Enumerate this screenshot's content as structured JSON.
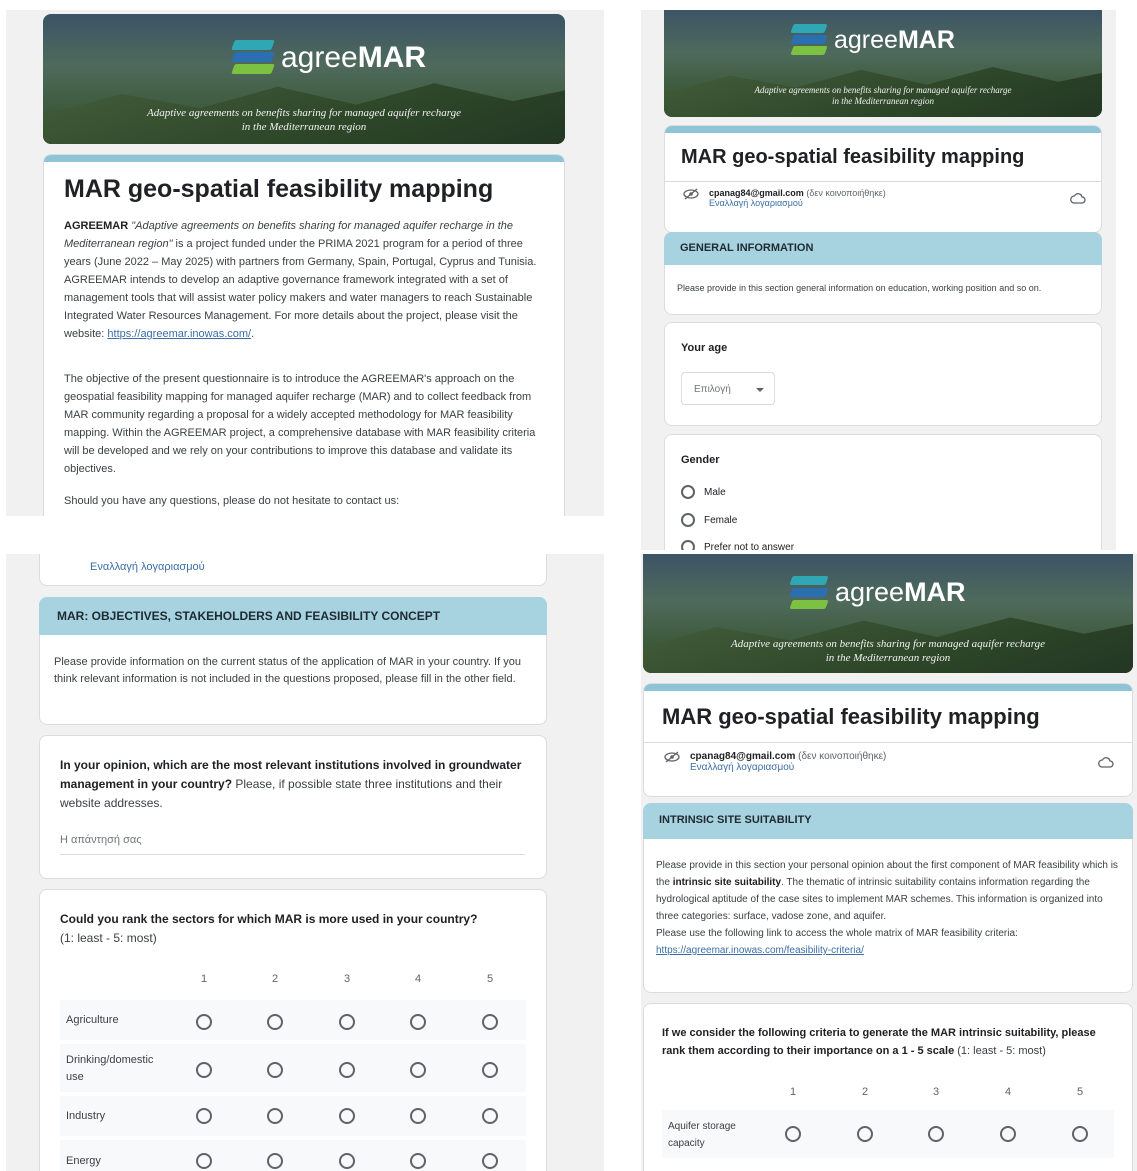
{
  "colors": {
    "accent": "#a7d3e0",
    "link": "#3a6ea5",
    "logo_teal": "#2fa7b5",
    "logo_blue": "#2c6fb0",
    "logo_green": "#7cc242"
  },
  "banner": {
    "brand_light": "agree",
    "brand_bold": "MAR",
    "tagline_line1": "Adaptive agreements on benefits sharing for managed aquifer recharge",
    "tagline_line2": "in the Mediterranean region"
  },
  "form_title": "MAR geo-spatial feasibility mapping",
  "account": {
    "email": "cpanag84@gmail.com",
    "not_shared": "(δεν κοινοποιήθηκε)",
    "switch": "Εναλλαγή λογαριασμού"
  },
  "p1": {
    "intro_brand": "AGREEMAR",
    "intro_quote": "\"Adaptive agreements on benefits sharing for managed aquifer recharge in the Mediterranean region\"",
    "intro_rest": " is a project funded under the PRIMA 2021 program for a period of three years (June 2022 – May 2025) with partners from Germany, Spain, Portugal, Cyprus and Tunisia. AGREEMAR intends to develop an adaptive governance framework integrated with a set of management tools that will assist water policy makers and water managers to reach Sustainable Integrated Water Resources Management. For more details about the project, please visit the website: ",
    "intro_link": "https://agreemar.inowas.com/",
    "intro_end": ".",
    "objective": "The objective of the present questionnaire is to introduce the AGREEMAR's approach on the geospatial feasibility mapping for managed aquifer recharge (MAR) and to collect feedback from MAR community regarding a proposal for a widely accepted methodology for MAR feasibility mapping. Within the AGREEMAR project, a comprehensive database with MAR feasibility criteria will be developed and we rely on your contributions to improve this database and validate its objectives.",
    "contact": "Should you have any questions, please do not hesitate to contact us:"
  },
  "p2": {
    "section": "GENERAL INFORMATION",
    "section_desc": "Please provide in this section general information on education, working position and so on.",
    "age_label": "Your age",
    "age_placeholder": "Επιλογή",
    "gender_label": "Gender",
    "gender_options": [
      "Male",
      "Female",
      "Prefer not to answer"
    ]
  },
  "p3": {
    "section": "MAR: OBJECTIVES, STAKEHOLDERS AND FEASIBILITY CONCEPT",
    "section_desc": "Please provide information on the current status of the application of MAR  in your country. If you think relevant information is not included in the questions proposed, please fill in the other field.",
    "q1_bold": "In your opinion, which are the most relevant institutions involved in groundwater management in your country?",
    "q1_rest": " Please, if possible state three institutions and their website addresses.",
    "q1_placeholder": "Η απάντησή σας",
    "q2_bold": "Could you rank the sectors for which MAR is more used in your country?",
    "q2_rest": "(1: least - 5: most)",
    "scale": [
      "1",
      "2",
      "3",
      "4",
      "5"
    ],
    "rows": [
      "Agriculture",
      "Drinking/domestic use",
      "Industry",
      "Energy"
    ]
  },
  "p4": {
    "section": "INTRINSIC SITE SUITABILITY",
    "desc_a": "Please provide in this section your personal opinion about the first component of MAR feasibility which is the ",
    "desc_bold": "intrinsic site suitability",
    "desc_b": ". The thematic of intrinsic suitability contains information regarding the hydrological aptitude of the case sites to implement MAR schemes. This information is organized into three categories: surface, vadose zone, and aquifer.",
    "desc_c": "Please use the following link to access the whole matrix of MAR feasibility criteria: ",
    "desc_link": "https://agreemar.inowas.com/feasibility-criteria/",
    "q_bold": "If we consider the following criteria to generate the MAR intrinsic suitability, please rank them according to their importance on a 1 - 5 scale",
    "q_rest": " (1: least - 5: most)",
    "scale": [
      "1",
      "2",
      "3",
      "4",
      "5"
    ],
    "rows": [
      "Aquifer storage capacity"
    ]
  }
}
